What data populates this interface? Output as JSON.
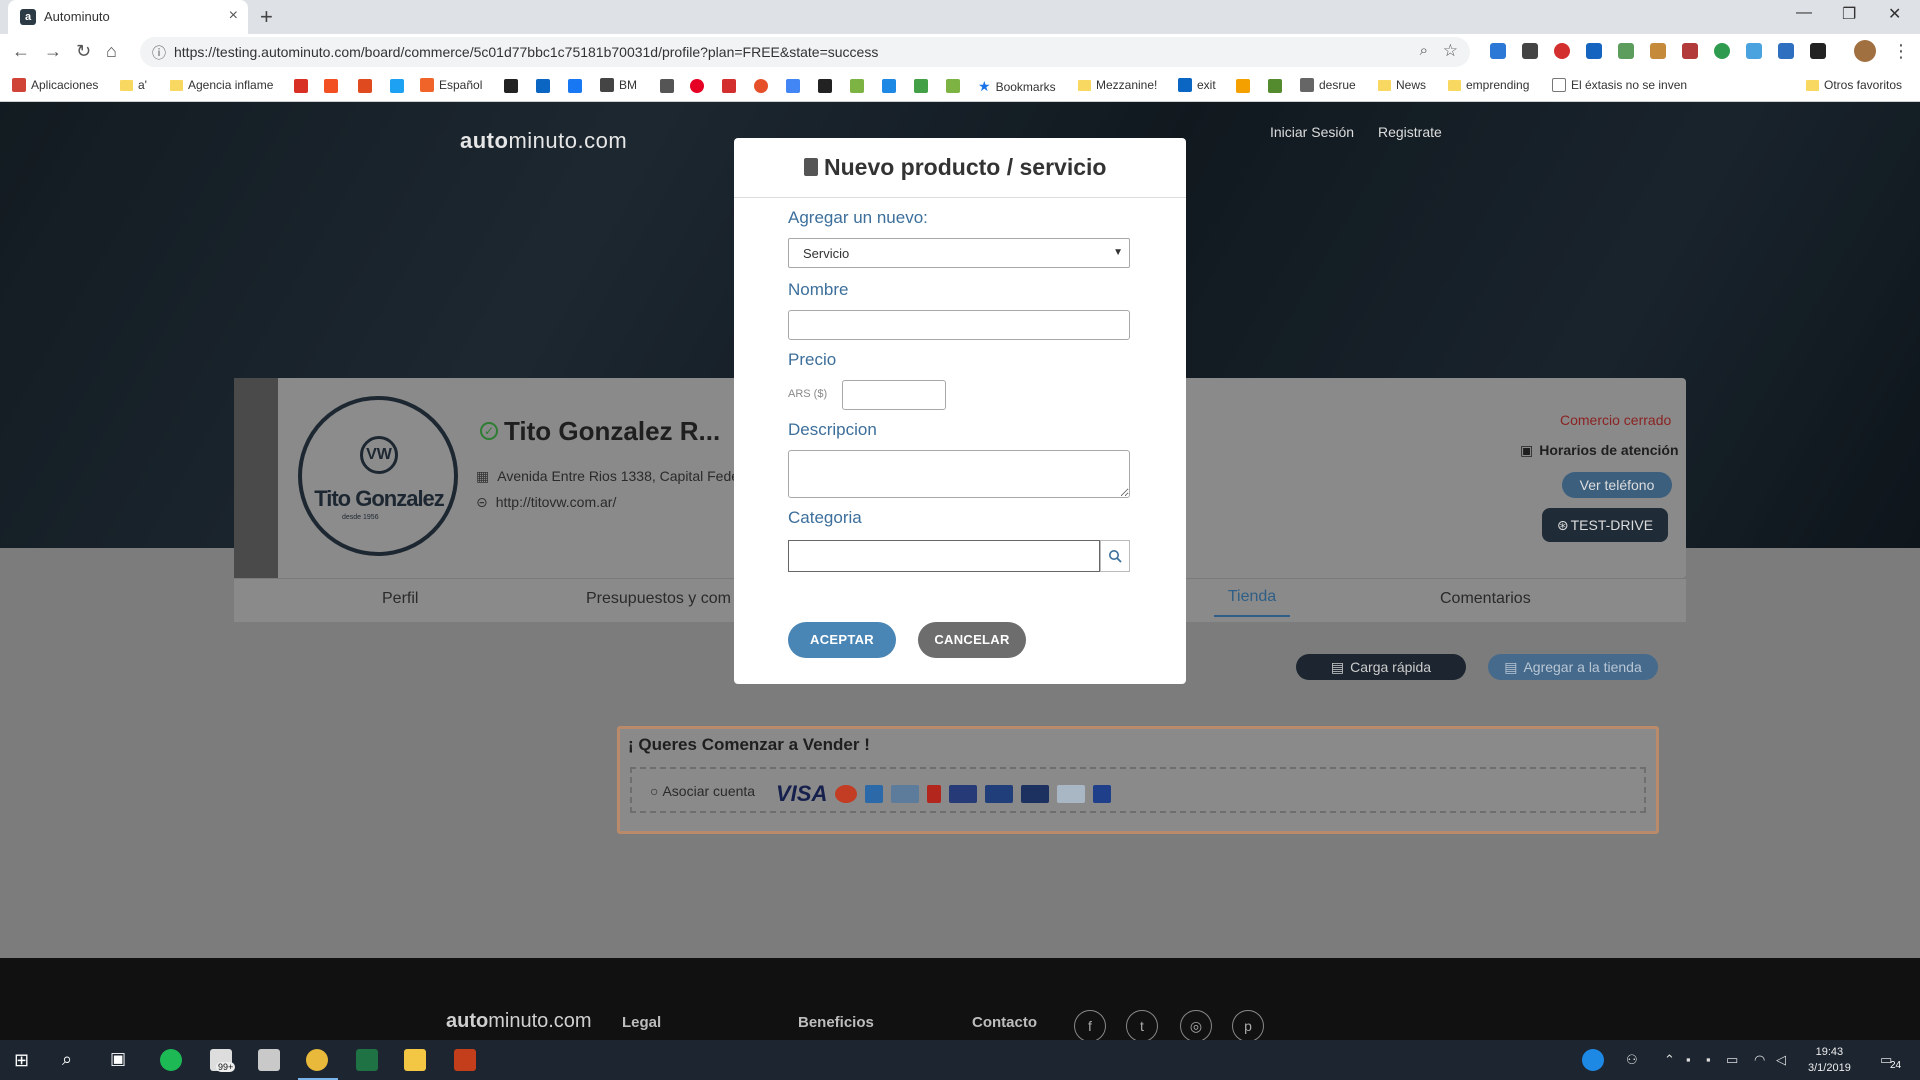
{
  "browser": {
    "tab_title": "Autominuto",
    "url": "https://testing.autominuto.com/board/commerce/5c01d77bbc1c75181b70031d/profile?plan=FREE&state=success",
    "bookmarks": [
      "Aplicaciones",
      "a'",
      "Agencia inflame",
      "Español",
      "BM",
      "Bookmarks",
      "Mezzanine!",
      "exit",
      "desrue",
      "News",
      "emprending",
      "El éxtasis no se inven",
      "Otros favoritos"
    ]
  },
  "site": {
    "logo_bold": "auto",
    "logo_rest": "minuto.com",
    "nav": {
      "login": "Iniciar Sesión",
      "register": "Registrate"
    }
  },
  "profile": {
    "brand_text": "Tito Gonzalez",
    "brand_sub": "desde 1956",
    "name": "Tito Gonzalez R...",
    "address": "Avenida Entre Rios 1338, Capital Fede",
    "website": "http://titovw.com.ar/",
    "status": "Comercio cerrado",
    "hours": "Horarios de atención",
    "phone_btn": "Ver teléfono",
    "testdrive_btn": "TEST-DRIVE",
    "tabs": [
      "Perfil",
      "Presupuestos y com",
      "Tienda",
      "Comentarios"
    ],
    "quick_load": "Carga rápida",
    "add_store": "Agregar a la tienda",
    "sell_title": "¡ Queres Comenzar a Vender !",
    "link_account": "Asociar cuenta",
    "visa": "VISA"
  },
  "footer": {
    "legal": "Legal",
    "benefits": "Beneficios",
    "contact": "Contacto"
  },
  "modal": {
    "title": "Nuevo producto / servicio",
    "add_label": "Agregar un nuevo:",
    "type_value": "Servicio",
    "name_label": "Nombre",
    "name_value": "",
    "price_label": "Precio",
    "currency": "ARS ($)",
    "price_value": "",
    "desc_label": "Descripcion",
    "desc_value": "",
    "cat_label": "Categoria",
    "cat_value": "",
    "accept": "ACEPTAR",
    "cancel": "CANCELAR"
  },
  "taskbar": {
    "time": "19:43",
    "date": "3/1/2019",
    "notif": "24",
    "badge": "99+"
  },
  "colors": {
    "accent_blue": "#4a86b5",
    "cancel_gray": "#6d6d6d",
    "label_blue": "#3c6f9b"
  }
}
